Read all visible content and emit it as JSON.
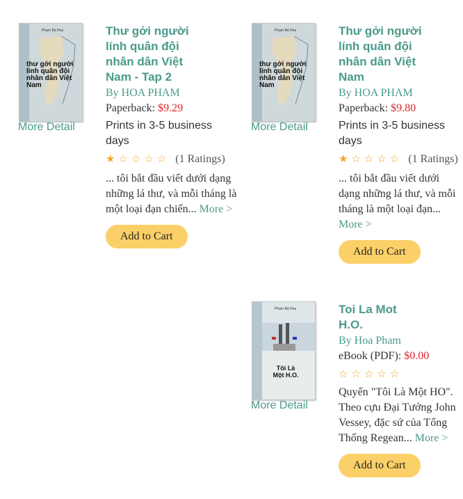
{
  "books": [
    {
      "title": "Thư gởi người lính quân đội nhân dân Việt Nam - Tap 2",
      "by_prefix": "By",
      "author": "HOA PHAM",
      "format": "Paperback:",
      "price": "$9.29",
      "prints": "Prints in 3-5 business days",
      "stars_filled": 1,
      "stars_total": 5,
      "ratings_text": "(1 Ratings)",
      "description": "... tôi bắt đầu viết dưới dạng những lá thư, và mỗi tháng là một loại đạn chiến...",
      "more_label": "More >",
      "more_detail_label": "More Detail",
      "add_to_cart_label": "Add to Cart",
      "cover": {
        "author": "Phạm Bá Hoa",
        "title": "thư gởi người lính quân đội nhân dân Việt Nam"
      }
    },
    {
      "title": "Thư gởi người lính quân đội nhân dân Việt Nam",
      "by_prefix": "By",
      "author": "HOA PHAM",
      "format": "Paperback:",
      "price": "$9.80",
      "prints": "Prints in 3-5 business days",
      "stars_filled": 1,
      "stars_total": 5,
      "ratings_text": "(1 Ratings)",
      "description": "... tôi bắt đầu viết dưới dạng những lá thư, và mỗi tháng là một loại đạn...",
      "more_label": "More >",
      "more_detail_label": "More Detail",
      "add_to_cart_label": "Add to Cart",
      "cover": {
        "author": "Phạm Bá Hoa",
        "title": "thư gởi người lính quân đội nhân dân Việt Nam"
      }
    },
    {
      "title": "Toi La Mot H.O.",
      "by_prefix": "By",
      "author": "Hoa Pham",
      "format": "eBook (PDF):",
      "price": "$0.00",
      "stars_filled": 0,
      "stars_total": 5,
      "description": "Quyển \"Tôi Là Một HO\". Theo cựu Đại Tướng John Vessey, đặc sứ của Tổng Thống Regean...",
      "more_label": "More >",
      "more_detail_label": "More Detail",
      "add_to_cart_label": "Add to Cart",
      "cover": {
        "author": "Phạm Bá Hoa",
        "title": "Tôi Là Một H.O."
      }
    }
  ],
  "colors": {
    "accent": "#4a9a8a",
    "price": "#e0222a",
    "button": "#fcd068",
    "star": "#f5a623"
  }
}
